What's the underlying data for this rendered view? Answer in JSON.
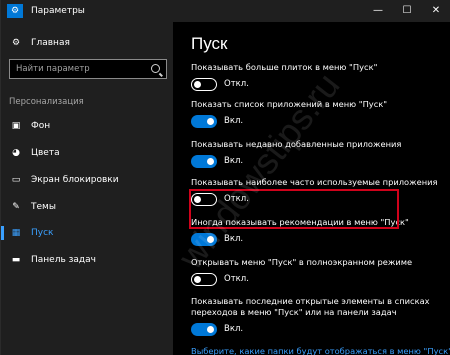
{
  "window": {
    "title": "Параметры"
  },
  "sidebar": {
    "home_label": "Главная",
    "search_placeholder": "Найти параметр",
    "section_label": "Персонализация",
    "items": [
      {
        "label": "Фон",
        "icon": "image-icon"
      },
      {
        "label": "Цвета",
        "icon": "palette-icon"
      },
      {
        "label": "Экран блокировки",
        "icon": "lock-screen-icon"
      },
      {
        "label": "Темы",
        "icon": "brush-icon"
      },
      {
        "label": "Пуск",
        "icon": "start-icon",
        "active": true
      },
      {
        "label": "Панель задач",
        "icon": "taskbar-icon"
      }
    ]
  },
  "main": {
    "title": "Пуск",
    "settings": [
      {
        "label": "Показывать больше плиток в меню \"Пуск\"",
        "state": "Откл.",
        "on": false
      },
      {
        "label": "Показать список приложений в меню \"Пуск\"",
        "state": "Вкл.",
        "on": true
      },
      {
        "label": "Показывать недавно добавленные приложения",
        "state": "Вкл.",
        "on": true
      },
      {
        "label": "Показывать наиболее часто используемые приложения",
        "state": "Откл.",
        "on": false
      },
      {
        "label": "Иногда показывать рекомендации в меню \"Пуск\"",
        "state": "Вкл.",
        "on": true
      },
      {
        "label": "Открывать меню \"Пуск\" в полноэкранном режиме",
        "state": "Откл.",
        "on": false
      },
      {
        "label": "Показывать последние открытые элементы в списках переходов в меню \"Пуск\" или на панели задач",
        "state": "Вкл.",
        "on": true
      }
    ],
    "link": "Выберите, какие папки будут отображаться в меню \"Пуск\""
  },
  "watermark": "windowstips.ru",
  "colors": {
    "accent": "#0078d7",
    "highlight_border": "#d0021b",
    "sidebar_bg": "#1f1f1f"
  }
}
